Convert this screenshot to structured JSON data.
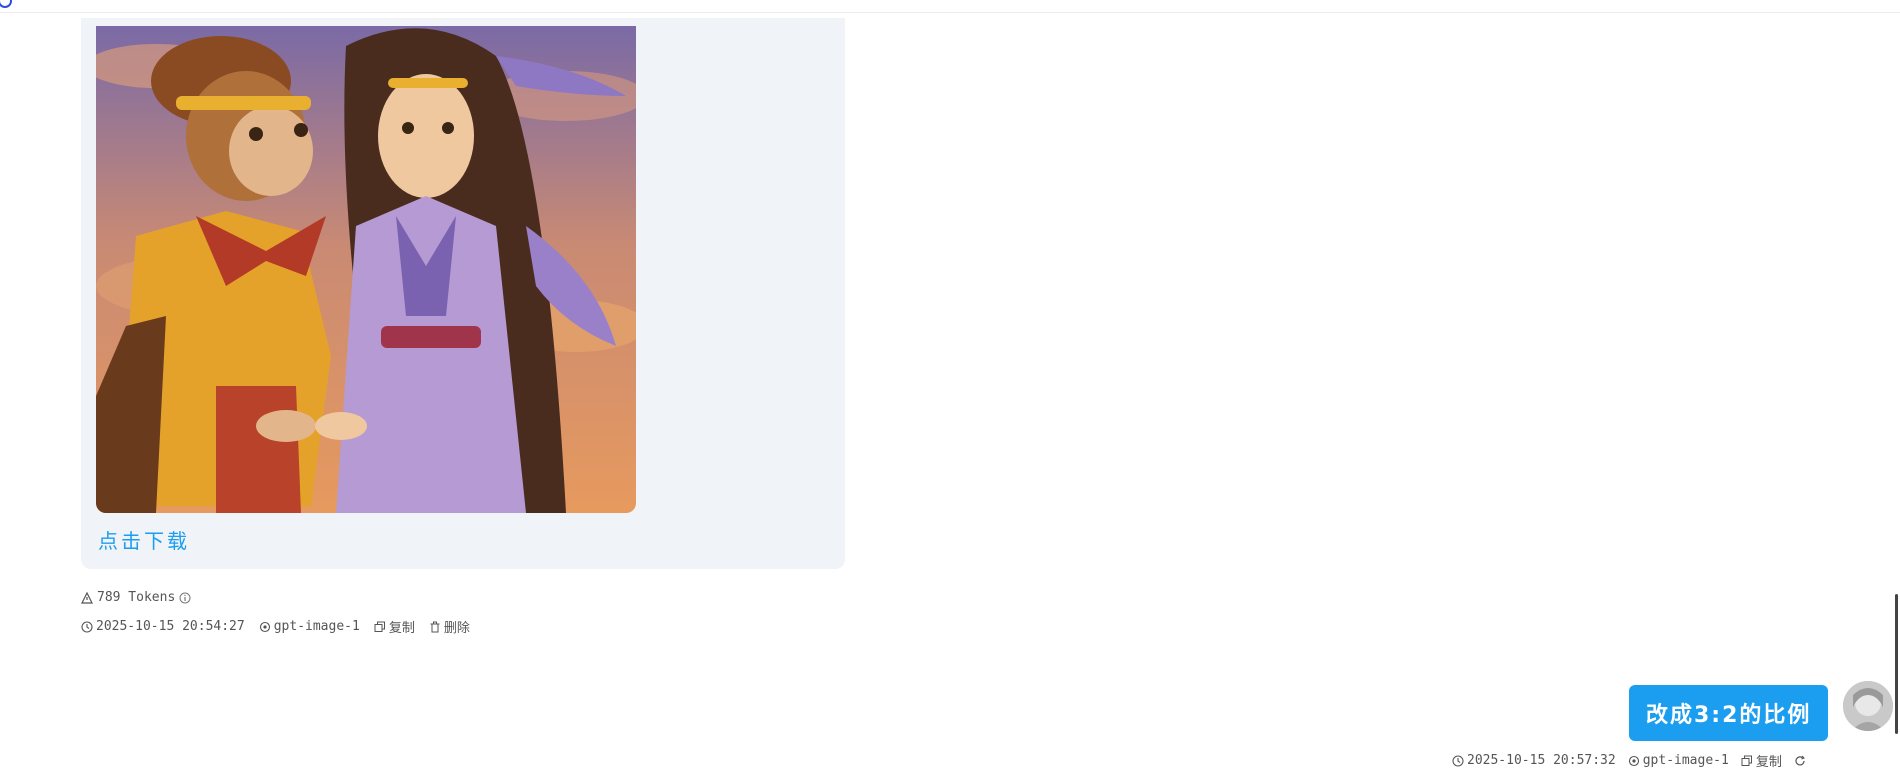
{
  "ai_message": {
    "image_alt": "Sun Wukong and a princess holding hands",
    "download_label": "点击下载",
    "tokens": "789 Tokens",
    "timestamp": "2025-10-15 20:54:27",
    "model": "gpt-image-1",
    "copy_label": "复制",
    "delete_label": "删除"
  },
  "user_message": {
    "text": "改成3:2的比例",
    "timestamp": "2025-10-15 20:57:32",
    "model": "gpt-image-1",
    "copy_label": "复制"
  },
  "colors": {
    "accent": "#1b9ef0",
    "ai_bubble_bg": "#f0f3f8",
    "meta_text": "#555555"
  },
  "icons": {
    "tokens": "tokens-icon",
    "info": "info-icon",
    "clock": "clock-icon",
    "model": "model-icon",
    "copy": "copy-icon",
    "delete": "trash-icon",
    "regenerate": "refresh-icon"
  }
}
